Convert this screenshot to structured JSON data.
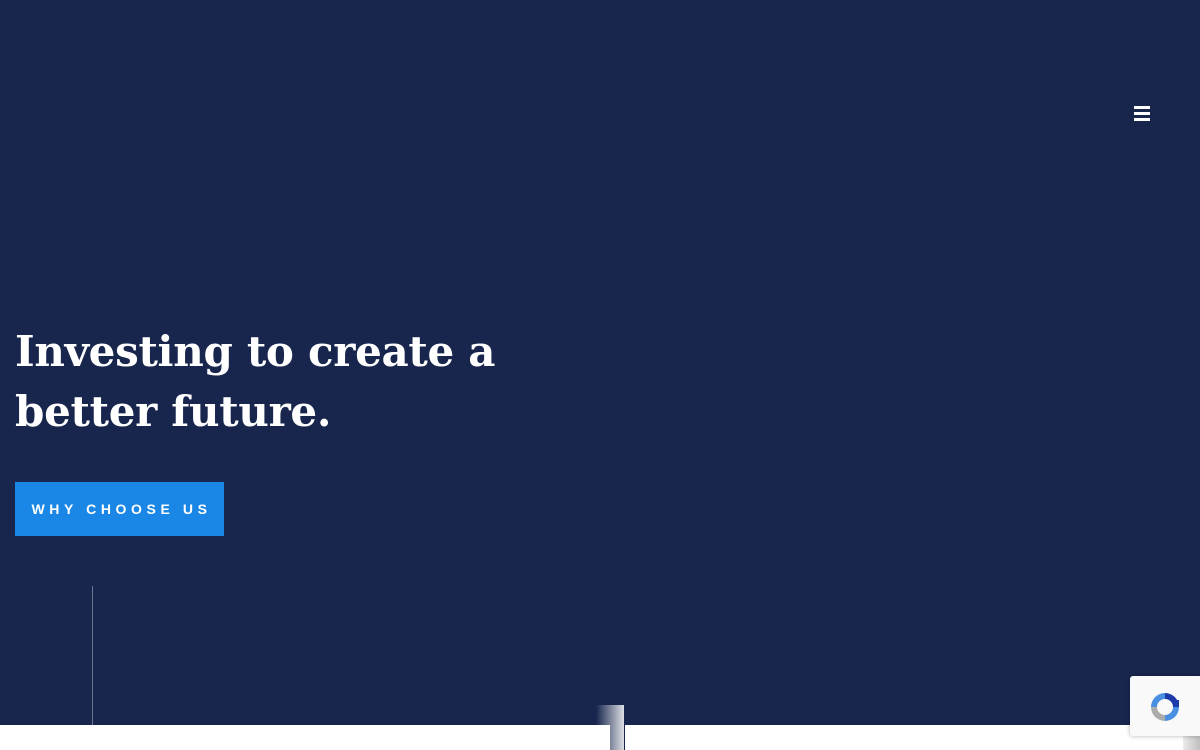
{
  "header": {
    "menu_icon": "hamburger-menu-icon"
  },
  "hero": {
    "title": "Investing to create a better future.",
    "cta_label": "WHY CHOOSE US"
  },
  "recaptcha": {
    "icon": "recaptcha-icon"
  },
  "colors": {
    "background": "#18264d",
    "accent": "#1a87e6",
    "text": "#ffffff"
  }
}
